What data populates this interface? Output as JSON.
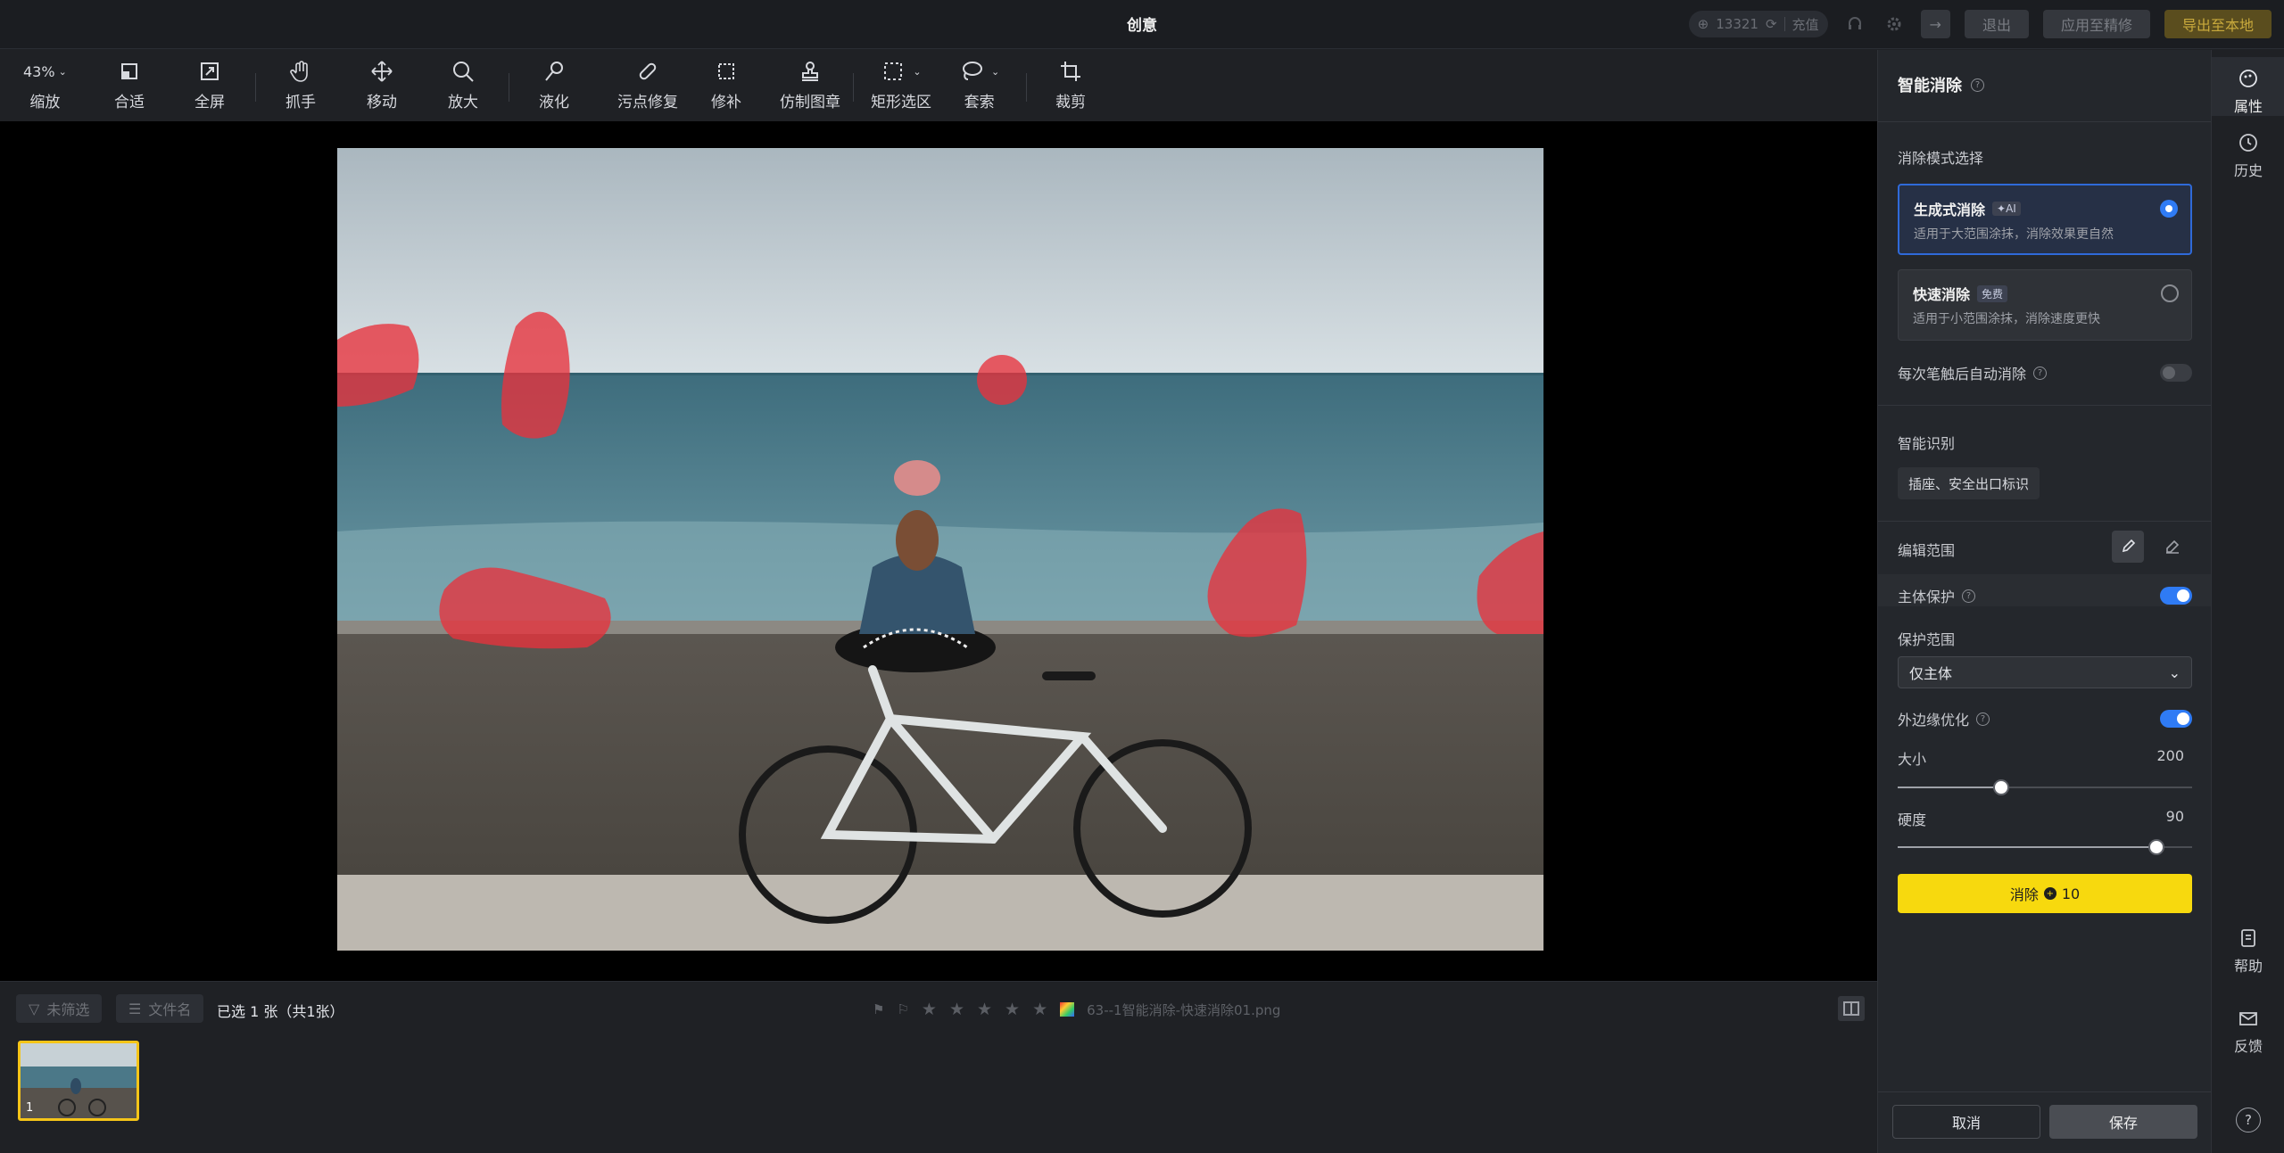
{
  "window": {
    "title": "创意",
    "credit_value": "13321",
    "recharge_label": "充值",
    "exit_label": "退出",
    "apply_label": "应用至精修",
    "export_label": "导出至本地"
  },
  "toolbar": {
    "zoom_value": "43%",
    "tools": [
      "缩放",
      "合适",
      "全屏",
      "抓手",
      "移动",
      "放大",
      "液化",
      "污点修复",
      "修补",
      "仿制图章",
      "矩形选区",
      "套索",
      "裁剪"
    ]
  },
  "bottom": {
    "filter_label": "未筛选",
    "sort_label": "文件名",
    "selection_text": "已选 1 张（共1张）",
    "filename": "63--1智能消除-快速消除01.png",
    "stars": [
      "★",
      "★",
      "★",
      "★",
      "★"
    ]
  },
  "filmstrip": {
    "items": [
      {
        "number": "1"
      }
    ]
  },
  "panel": {
    "title": "智能消除",
    "mode_section": "消除模式选择",
    "modes": [
      {
        "title": "生成式消除",
        "tag": "✦AI",
        "desc": "适用于大范围涂抹，消除效果更自然",
        "selected": true
      },
      {
        "title": "快速消除",
        "tag": "免费",
        "desc": "适用于小范围涂抹，消除速度更快",
        "selected": false
      }
    ],
    "auto_erase_label": "每次笔触后自动消除",
    "smart_detect_label": "智能识别",
    "detect_tag": "插座、安全出口标识",
    "edit_range_label": "编辑范围",
    "subject_protect_label": "主体保护",
    "protect_range_label": "保护范围",
    "protect_range_value": "仅主体",
    "edge_opt_label": "外边缘优化",
    "size_label": "大小",
    "size_value": "200",
    "size_fraction": 0.35,
    "hardness_label": "硬度",
    "hardness_value": "90",
    "hardness_fraction": 0.88,
    "erase_label": "消除",
    "erase_cost": "10",
    "cancel_label": "取消",
    "save_label": "保存"
  },
  "rail": {
    "properties": "属性",
    "history": "历史",
    "help": "帮助",
    "feedback": "反馈",
    "question": "?"
  },
  "colors": {
    "accent_blue": "#2f7bf5",
    "erase_yellow": "#f7d90e",
    "mask_red": "#e8323c",
    "thumb_border": "#f5c518"
  }
}
